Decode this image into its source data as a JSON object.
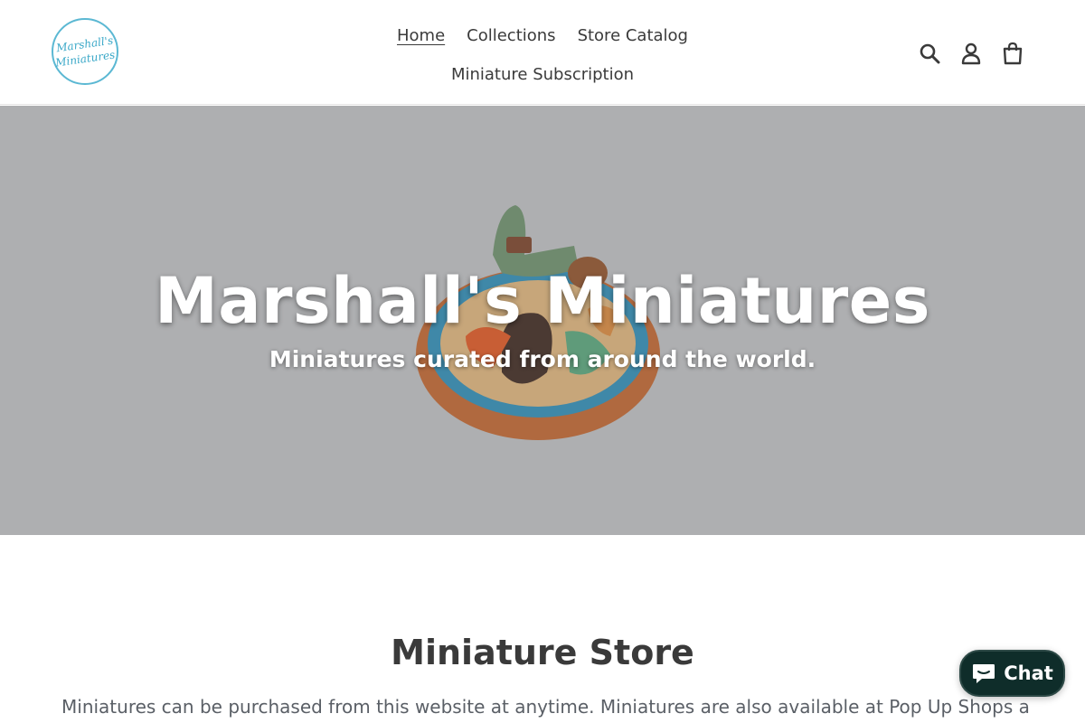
{
  "logo": {
    "line1": "Marshall's",
    "line2": "Miniatures"
  },
  "nav": {
    "items": [
      {
        "label": "Home",
        "active": true
      },
      {
        "label": "Collections"
      },
      {
        "label": "Store Catalog"
      },
      {
        "label": "Miniature Subscription"
      }
    ]
  },
  "header_icons": [
    "search-icon",
    "account-icon",
    "cart-icon"
  ],
  "hero": {
    "title": "Marshall's Miniatures",
    "subtitle": "Miniatures curated from around the world."
  },
  "section": {
    "title": "Miniature Store",
    "body": "Miniatures can be purchased from this website at anytime. Miniatures are also available at Pop Up Shops at"
  },
  "chat": {
    "label": "Chat",
    "icon": "chat-bubble-icon"
  },
  "colors": {
    "hero_bg": "#aeafb1",
    "logo_accent": "#5bb8d3",
    "chat_bg": "#0f2d2a"
  }
}
